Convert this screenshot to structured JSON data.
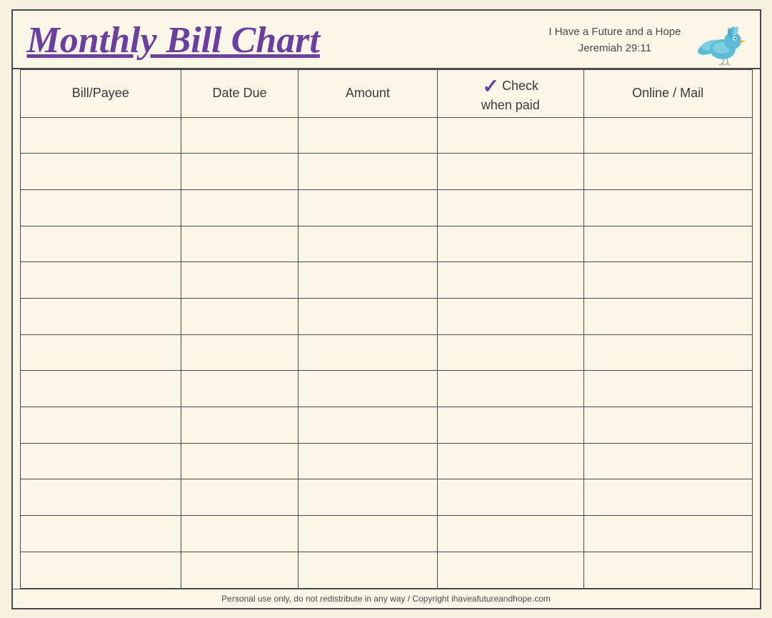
{
  "header": {
    "title": "Monthly Bill Chart",
    "tagline_line1": "I Have a Future and a Hope",
    "tagline_line2": "Jeremiah 29:11"
  },
  "table": {
    "columns": [
      {
        "id": "bill",
        "label": "Bill/Payee",
        "class": "col-bill"
      },
      {
        "id": "date",
        "label": "Date Due",
        "class": "col-date"
      },
      {
        "id": "amount",
        "label": "Amount",
        "class": "col-amount"
      },
      {
        "id": "check",
        "label": "when paid",
        "class": "col-check",
        "prefix": "✓",
        "prefix_label": "Check"
      },
      {
        "id": "online",
        "label": "Online / Mail",
        "class": "col-online"
      }
    ],
    "row_count": 13
  },
  "footer": {
    "text": "Personal use only, do not redistribute in any way / Copyright ihaveafutureandhope.com"
  }
}
